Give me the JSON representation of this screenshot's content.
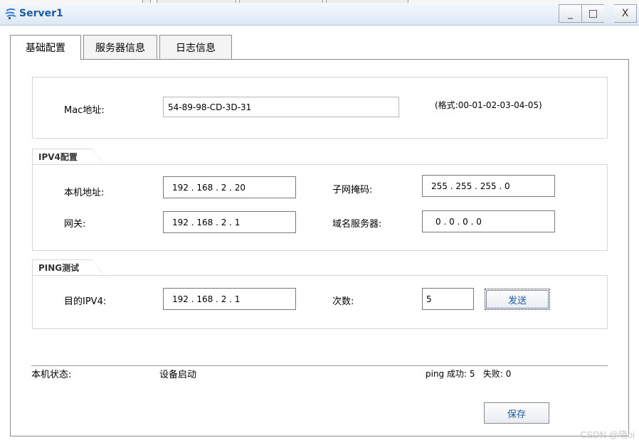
{
  "window": {
    "title": "Server1",
    "minimize_glyph": "_",
    "maximize_glyph": "□",
    "close_glyph": "X",
    "app_icon": "server-icon"
  },
  "tabs": [
    {
      "label": "基础配置",
      "active": true
    },
    {
      "label": "服务器信息",
      "active": false
    },
    {
      "label": "日志信息",
      "active": false
    }
  ],
  "mac": {
    "label": "Mac地址:",
    "value": "54-89-98-CD-3D-31",
    "format_hint": "(格式:00-01-02-03-04-05)"
  },
  "ipv4": {
    "group_title": "IPV4配置",
    "local_ip_label": "本机地址:",
    "local_ip": "192 . 168 . 2 . 20",
    "subnet_label": "子网掩码:",
    "subnet": "255 . 255 . 255 . 0",
    "gateway_label": "网关:",
    "gateway": "192 . 168 . 2 . 1",
    "dns_label": "域名服务器:",
    "dns": "0 . 0 . 0 . 0"
  },
  "ping": {
    "group_title": "PING测试",
    "target_label": "目的IPV4:",
    "target": "192 . 168 . 2 . 1",
    "count_label": "次数:",
    "count": "5",
    "send_label": "发送"
  },
  "status": {
    "label": "本机状态:",
    "value": "设备启动",
    "ping_result": "ping 成功: 5   失败: 0"
  },
  "save_label": "保存",
  "watermark": "CSDN @晓oi",
  "colors": {
    "title_text": "#1e5aa0",
    "button_text": "#1e5aa0",
    "border": "#8a8a8a"
  }
}
